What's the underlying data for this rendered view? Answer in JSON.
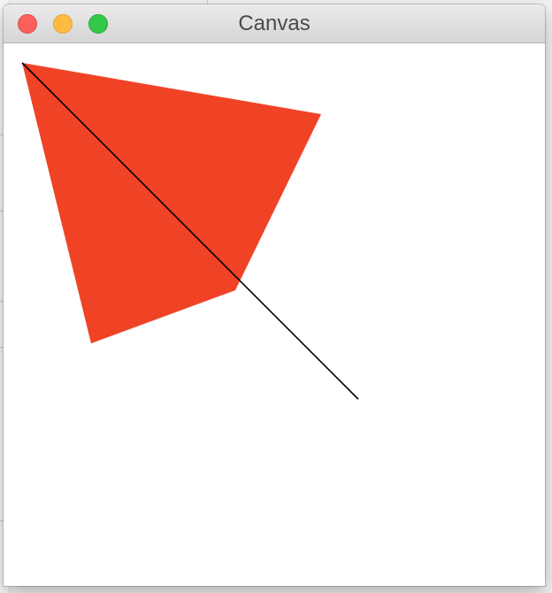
{
  "window": {
    "title": "Canvas"
  },
  "icons": {
    "close": "close-traffic-light-icon",
    "minimize": "minimize-traffic-light-icon",
    "zoom": "zoom-traffic-light-icon"
  },
  "colors": {
    "close": "#fc605c",
    "minimize": "#fdbc40",
    "zoom": "#34c84a",
    "shape_fill": "#f04326",
    "line_stroke": "#000000"
  }
}
